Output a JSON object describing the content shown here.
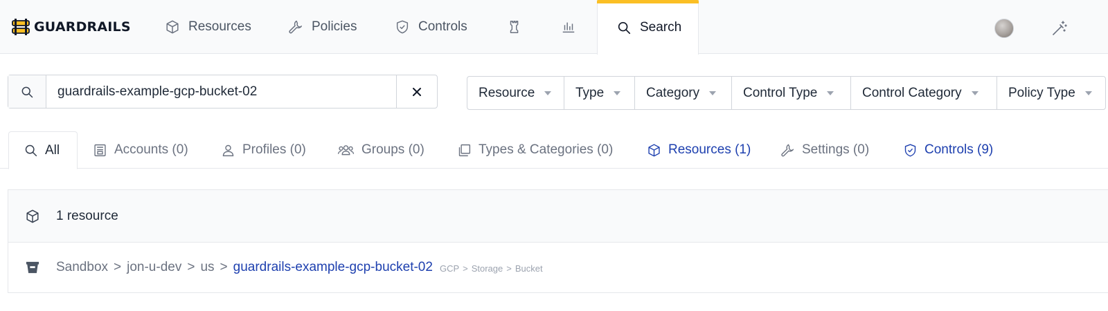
{
  "app": {
    "brand": "GUARDRAILS",
    "brand_color": "#fbbf24",
    "accent_color": "#1e40af"
  },
  "nav": {
    "items": [
      {
        "label": "Resources",
        "icon": "cube-icon"
      },
      {
        "label": "Policies",
        "icon": "wrench-icon"
      },
      {
        "label": "Controls",
        "icon": "shield-check-icon"
      },
      {
        "label": "",
        "icon": "chess-rook-icon"
      },
      {
        "label": "",
        "icon": "bar-chart-icon"
      },
      {
        "label": "Search",
        "icon": "search-icon",
        "active": true
      }
    ]
  },
  "search": {
    "value": "guardrails-example-gcp-bucket-02"
  },
  "filters": [
    "Resource",
    "Type",
    "Category",
    "Control Type",
    "Control Category",
    "Policy Type"
  ],
  "tabs": [
    {
      "label": "All",
      "icon": "search-icon",
      "active": true
    },
    {
      "label": "Accounts (0)",
      "icon": "account-icon"
    },
    {
      "label": "Profiles (0)",
      "icon": "user-icon"
    },
    {
      "label": "Groups (0)",
      "icon": "users-icon"
    },
    {
      "label": "Types & Categories (0)",
      "icon": "copy-icon"
    },
    {
      "label": "Resources (1)",
      "icon": "cube-icon",
      "highlight": true
    },
    {
      "label": "Settings (0)",
      "icon": "wrench-icon"
    },
    {
      "label": "Controls (9)",
      "icon": "shield-check-icon",
      "highlight": true
    }
  ],
  "results": {
    "header": "1 resource",
    "items": [
      {
        "path": [
          "Sandbox",
          "jon-u-dev",
          "us"
        ],
        "name": "guardrails-example-gcp-bucket-02",
        "type_path": [
          "GCP",
          "Storage",
          "Bucket"
        ],
        "icon": "bucket-icon"
      }
    ]
  }
}
